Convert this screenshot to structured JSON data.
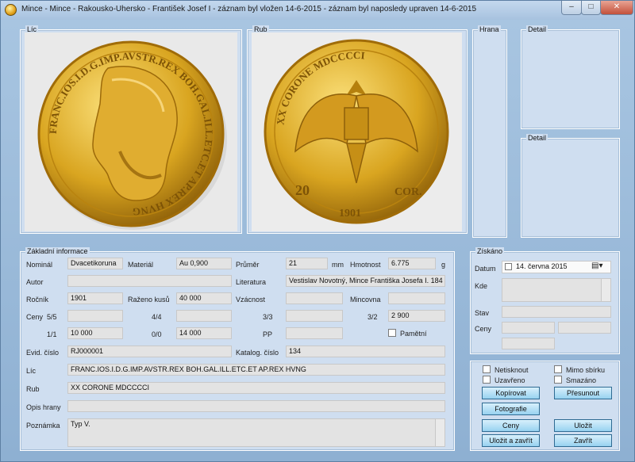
{
  "window": {
    "title": "Mince - Mince - Rakousko-Uhersko - František Josef I - záznam byl vložen 14-6-2015 - záznam byl naposledy upraven 14-6-2015",
    "min_label": "–",
    "max_label": "□",
    "close_label": "✕"
  },
  "panels": {
    "lic": "Líc",
    "rub": "Rub",
    "hrana": "Hrana",
    "detail1": "Detail",
    "detail2": "Detail"
  },
  "coin": {
    "obverse_legend": "FRANC.IOS.I.D.G.IMP.AVSTR.REX BOH.GAL.ILL.ETC.ET AP.REX HVNG",
    "reverse_top": "XX CORONE MDCCCCI",
    "reverse_left": "20",
    "reverse_right": "COR.",
    "reverse_year": "1901"
  },
  "basic": {
    "title": "Základní informace",
    "nominal_label": "Nominál",
    "nominal": "Dvacetikoruna",
    "material_label": "Materiál",
    "material": "Au 0,900",
    "prumer_label": "Průměr",
    "prumer": "21",
    "mm": "mm",
    "hmotnost_label": "Hmotnost",
    "hmotnost": "6.775",
    "g": "g",
    "autor_label": "Autor",
    "autor": "",
    "literatura_label": "Literatura",
    "literatura": "Vestislav Novotný, Mince Františka Josefa I. 184",
    "rocnik_label": "Ročník",
    "rocnik": "1901",
    "razeno_label": "Raženo kusů",
    "razeno": "40 000",
    "vzacnost_label": "Vzácnost",
    "vzacnost": "",
    "mincovna_label": "Mincovna",
    "mincovna": "",
    "ceny_label": "Ceny",
    "g55_label": "5/5",
    "g55": "",
    "g44_label": "4/4",
    "g44": "",
    "g33_label": "3/3",
    "g33": "",
    "g32_label": "3/2",
    "g32": "2 900",
    "g11_label": "1/1",
    "g11": "10 000",
    "g00_label": "0/0",
    "g00": "14 000",
    "pp_label": "PP",
    "pp": "",
    "pametni_label": "Pamětní",
    "evid_label": "Evid. číslo",
    "evid": "RJ000001",
    "katalog_label": "Katalog. číslo",
    "katalog": "134",
    "lic_label": "Líc",
    "lic": "FRANC.IOS.I.D.G.IMP.AVSTR.REX BOH.GAL.ILL.ETC.ET AP.REX HVNG",
    "rub_label": "Rub",
    "rub": "XX CORONE MDCCCCI",
    "opis_label": "Opis hrany",
    "opis": "",
    "poznamka_label": "Poznámka",
    "poznamka": "Typ V."
  },
  "ziskano": {
    "title": "Získáno",
    "datum_label": "Datum",
    "datum": "14. června 2015",
    "kde_label": "Kde",
    "kde": "",
    "stav_label": "Stav",
    "stav": "",
    "ceny_label": "Ceny",
    "cena1": "",
    "cena2": "",
    "cena3": ""
  },
  "actions": {
    "netisknout": "Netisknout",
    "mimo_sbirku": "Mimo sbírku",
    "uzavreno": "Uzavřeno",
    "smazano": "Smazáno",
    "kopirovat": "Kopírovat",
    "presunout": "Přesunout",
    "fotografie": "Fotografie",
    "ceny": "Ceny",
    "ulozit": "Uložit",
    "ulozit_zavrit": "Uložit a zavřít",
    "zavrit": "Zavřít"
  },
  "colors": {
    "window_bg": "#a9c6e2",
    "panel_bg": "#cfdef0",
    "button_bg": "#98d2f0",
    "gold": "#d9a520"
  }
}
